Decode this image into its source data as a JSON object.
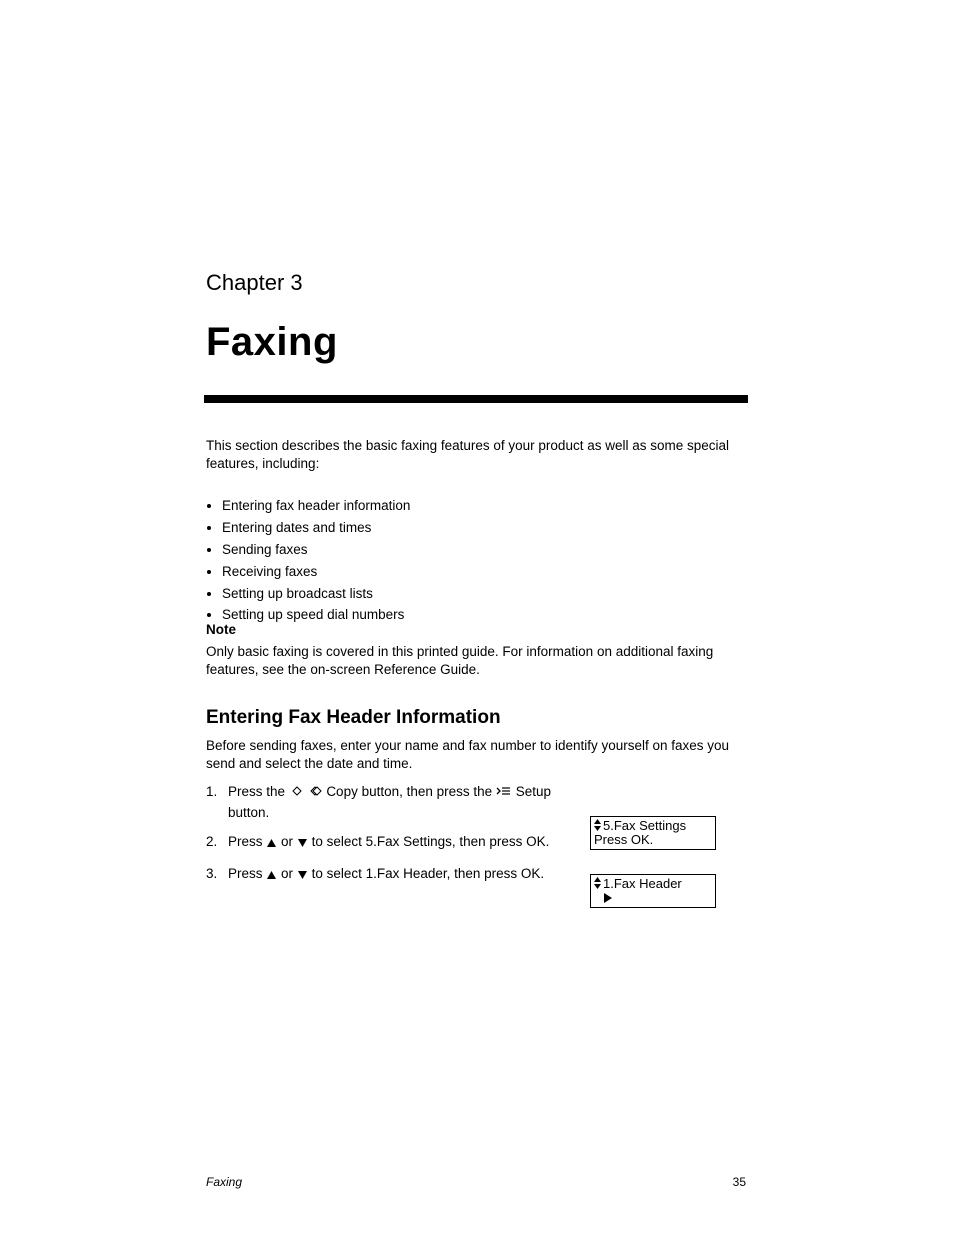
{
  "chapter": {
    "num": "Chapter 3",
    "title": "Faxing"
  },
  "intro": "This section describes the basic faxing features of your product as well as some special features, including:",
  "bullets": [
    "Entering fax header information",
    "Entering dates and times",
    "Sending faxes",
    "Receiving faxes",
    "Setting up broadcast lists",
    "Setting up speed dial numbers"
  ],
  "note": {
    "label": "Note",
    "body": "Only basic faxing is covered in this printed guide. For information on additional faxing features, see the on-screen Reference Guide."
  },
  "section": {
    "title": "Entering Fax Header Information",
    "body": "Before sending faxes, enter your name and fax number to identify yourself on faxes you send and select the date and time."
  },
  "steps": [
    {
      "n": "1.",
      "pre": "Press the ",
      "icons": "copy",
      "post": " Copy button, then press the ",
      "icons2": "setup",
      "post2": " Setup button."
    },
    {
      "n": "2.",
      "pre": "Press ",
      "arrows": true,
      "mid": " or ",
      "post": " to select 5.Fax Settings, then press OK."
    },
    {
      "n": "3.",
      "pre": "Press ",
      "arrows": true,
      "mid": " or ",
      "post": " to select 1.Fax Header, then press OK."
    }
  ],
  "step_select_text": {
    "s2_tail": "5.Fax Settings",
    "s2_tail2": ", then press OK.",
    "s3_tail": "1.Fax Header",
    "s3_tail2": ", then press OK."
  },
  "lcd1": {
    "line1_pre": "5.Fax Settings",
    "line2": "Press OK."
  },
  "lcd2": {
    "line1_pre": "1.Fax Header"
  },
  "footer": {
    "left": "Faxing",
    "right": "35"
  }
}
